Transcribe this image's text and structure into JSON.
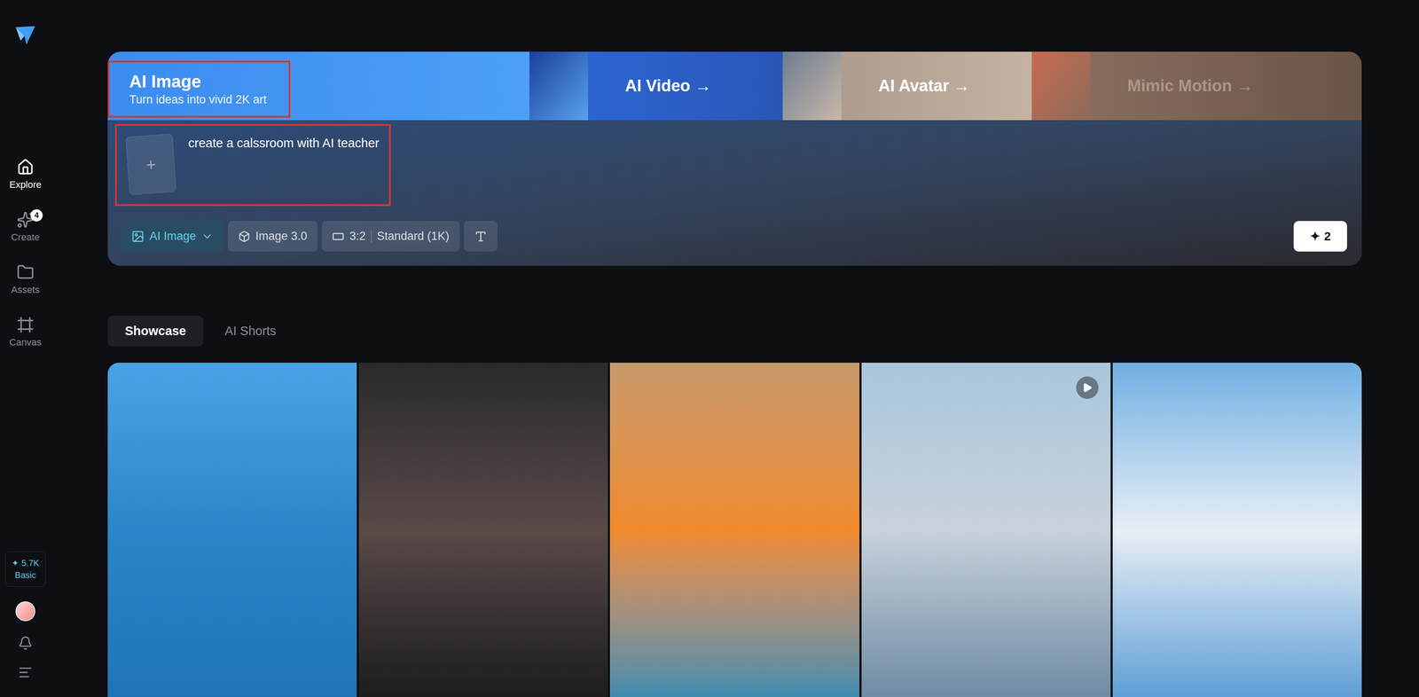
{
  "sidebar": {
    "items": [
      {
        "label": "Explore",
        "selected": true,
        "badge": ""
      },
      {
        "label": "Create",
        "selected": false,
        "badge": "4"
      },
      {
        "label": "Assets",
        "selected": false,
        "badge": ""
      },
      {
        "label": "Canvas",
        "selected": false,
        "badge": ""
      }
    ],
    "credits": {
      "icon": "✦",
      "amount": "5.7K",
      "plan": "Basic"
    }
  },
  "hero": {
    "modes": [
      {
        "label": "AI Image",
        "subtitle": "Turn ideas into vivid 2K art",
        "arrow": "",
        "selected": true,
        "disabled": false,
        "annotated": true
      },
      {
        "label": "AI Video",
        "subtitle": "",
        "arrow": "→",
        "selected": false,
        "disabled": false,
        "annotated": false
      },
      {
        "label": "AI Avatar",
        "subtitle": "",
        "arrow": "→",
        "selected": false,
        "disabled": false,
        "annotated": false
      },
      {
        "label": "Mimic Motion",
        "subtitle": "",
        "arrow": "→",
        "selected": false,
        "disabled": true,
        "annotated": false
      }
    ]
  },
  "prompt": {
    "upload": "+",
    "text": "create a calssroom with AI teacher",
    "annotated": true
  },
  "toolbar": {
    "items": [
      {
        "kind": "mode",
        "label": "AI Image",
        "selected": true
      },
      {
        "kind": "model",
        "label": "Image 3.0",
        "selected": false
      },
      {
        "kind": "size",
        "ratio": "3:2",
        "quality": "Standard (1K)",
        "selected": false
      },
      {
        "kind": "text-style",
        "selected": false
      }
    ],
    "generate": {
      "icon": "✦",
      "cost": "2"
    }
  },
  "gallery": {
    "tabs": [
      {
        "label": "Showcase",
        "selected": true
      },
      {
        "label": "AI Shorts",
        "selected": false
      }
    ],
    "items": [
      {
        "video": false
      },
      {
        "video": false
      },
      {
        "video": false
      },
      {
        "video": true
      },
      {
        "video": false
      }
    ]
  }
}
